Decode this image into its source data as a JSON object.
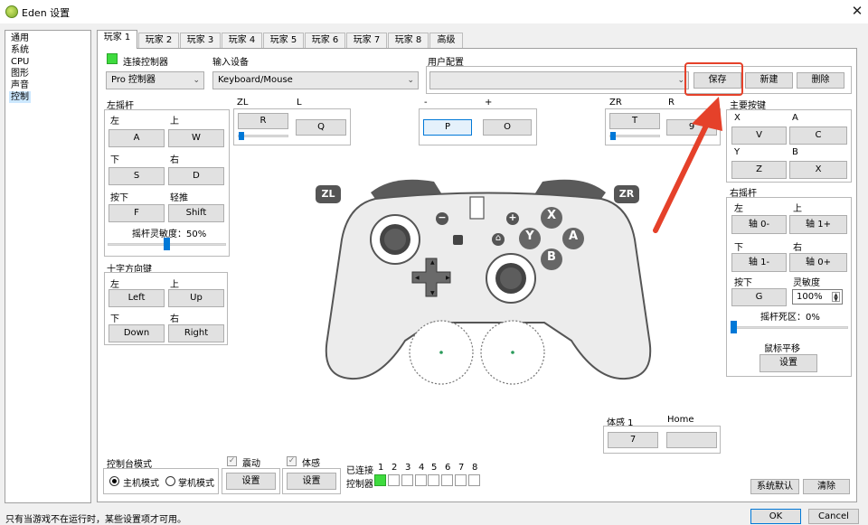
{
  "window": {
    "title": "Eden 设置",
    "close_glyph": "✕"
  },
  "sidebar": {
    "items": [
      {
        "label": "通用",
        "selected": false
      },
      {
        "label": "系统",
        "selected": false
      },
      {
        "label": "CPU",
        "selected": false
      },
      {
        "label": "图形",
        "selected": false
      },
      {
        "label": "声音",
        "selected": false
      },
      {
        "label": "控制",
        "selected": true
      }
    ]
  },
  "tabs": [
    "玩家 1",
    "玩家 2",
    "玩家 3",
    "玩家 4",
    "玩家 5",
    "玩家 6",
    "玩家 7",
    "玩家 8",
    "高级"
  ],
  "active_tab": 0,
  "top": {
    "connect_label": "连接控制器",
    "connected": true,
    "controller_type": "Pro 控制器",
    "input_device_label": "输入设备",
    "input_device": "Keyboard/Mouse",
    "profile_label": "用户配置",
    "profile_value": "",
    "save": "保存",
    "new": "新建",
    "delete": "删除"
  },
  "left_stick": {
    "title": "左摇杆",
    "left_label": "左",
    "left_key": "A",
    "up_label": "上",
    "up_key": "W",
    "down_label": "下",
    "down_key": "S",
    "right_label": "右",
    "right_key": "D",
    "press_label": "按下",
    "press_key": "F",
    "light_label": "轻推",
    "light_key": "Shift",
    "sensitivity": "摇杆灵敏度：50%",
    "sensitivity_value": 0.5
  },
  "dpad": {
    "title": "十字方向键",
    "left_label": "左",
    "left_key": "Left",
    "up_label": "上",
    "up_key": "Up",
    "down_label": "下",
    "down_key": "Down",
    "right_label": "右",
    "right_key": "Right"
  },
  "shoulders": {
    "zl_label": "ZL",
    "zl_key": "R",
    "l_label": "L",
    "l_key": "Q",
    "minus_label": "-",
    "minus_key": "P",
    "plus_label": "+",
    "plus_key": "O",
    "zr_label": "ZR",
    "zr_key": "T",
    "r_label": "R",
    "r_key": "9"
  },
  "controller_graphic": {
    "zl": "ZL",
    "zr": "ZR",
    "x": "X",
    "y": "Y",
    "a": "A",
    "b": "B",
    "minus": "−",
    "plus": "+",
    "home": "⌂"
  },
  "face_buttons": {
    "title": "主要按键",
    "x_label": "X",
    "x_key": "V",
    "a_label": "A",
    "a_key": "C",
    "y_label": "Y",
    "y_key": "Z",
    "b_label": "B",
    "b_key": "X"
  },
  "right_stick": {
    "title": "右摇杆",
    "left_label": "左",
    "left_key": "轴 0-",
    "up_label": "上",
    "up_key": "轴 1+",
    "down_label": "下",
    "down_key": "轴 1-",
    "right_label": "右",
    "right_key": "轴 0+",
    "press_label": "按下",
    "press_key": "G",
    "sensitivity_label": "灵敏度",
    "sensitivity": "100%",
    "deadzone": "摇杆死区：0%",
    "deadzone_value": 0.0,
    "mouse_panning": "鼠标平移",
    "settings": "设置"
  },
  "motion": {
    "motion1_label": "体感 1",
    "motion1_key": "7",
    "home_label": "Home",
    "home_key": ""
  },
  "console_mode": {
    "title": "控制台模式",
    "docked": "主机模式",
    "handheld": "掌机模式",
    "docked_selected": true
  },
  "vibration": {
    "label": "震动",
    "checked": true,
    "settings": "设置"
  },
  "motion_settings": {
    "label": "体感",
    "checked": true,
    "settings": "设置"
  },
  "connected": {
    "label": "已连接",
    "controller_label": "控制器",
    "numbers": [
      "1",
      "2",
      "3",
      "4",
      "5",
      "6",
      "7",
      "8"
    ],
    "states": [
      true,
      false,
      false,
      false,
      false,
      false,
      false,
      false
    ]
  },
  "bottom_buttons": {
    "defaults": "系统默认",
    "clear": "清除"
  },
  "status": {
    "text": "只有当游戏不在运行时，某些设置项才可用。",
    "ok": "OK",
    "cancel": "Cancel"
  },
  "colors": {
    "accent": "#0078d7",
    "connected": "#3edb3e",
    "annotation": "#e5412a"
  }
}
